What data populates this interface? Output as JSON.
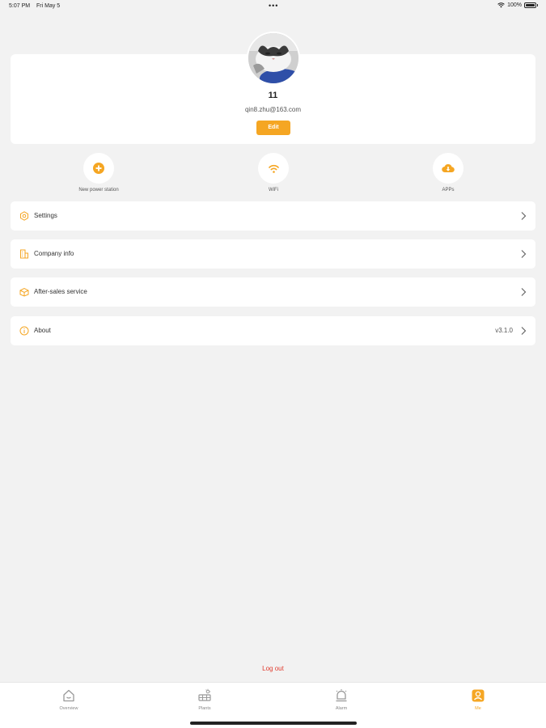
{
  "status_bar": {
    "time": "5:07 PM",
    "date": "Fri May 5",
    "dots": "•••",
    "battery": "100%"
  },
  "profile": {
    "username": "11",
    "email": "qin8.zhu@163.com",
    "edit_label": "Edit"
  },
  "shortcuts": [
    {
      "label": "New power station",
      "icon": "plus-circle-icon"
    },
    {
      "label": "WiFi",
      "icon": "wifi-icon"
    },
    {
      "label": "APPs",
      "icon": "cloud-download-icon"
    }
  ],
  "menu": [
    {
      "label": "Settings",
      "icon": "gear-icon",
      "value": ""
    },
    {
      "label": "Company info",
      "icon": "building-icon",
      "value": ""
    },
    {
      "label": "After-sales service",
      "icon": "service-box-icon",
      "value": ""
    },
    {
      "label": "About",
      "icon": "info-icon",
      "value": "v3.1.0"
    }
  ],
  "logout_label": "Log out",
  "tabs": [
    {
      "label": "Overview",
      "icon": "home-icon",
      "active": false
    },
    {
      "label": "Plants",
      "icon": "plant-icon",
      "active": false
    },
    {
      "label": "Alarm",
      "icon": "bell-icon",
      "active": false
    },
    {
      "label": "Me",
      "icon": "user-icon",
      "active": true
    }
  ],
  "colors": {
    "accent": "#f5a623",
    "background": "#f2f2f2",
    "logout": "#e03b2e"
  }
}
